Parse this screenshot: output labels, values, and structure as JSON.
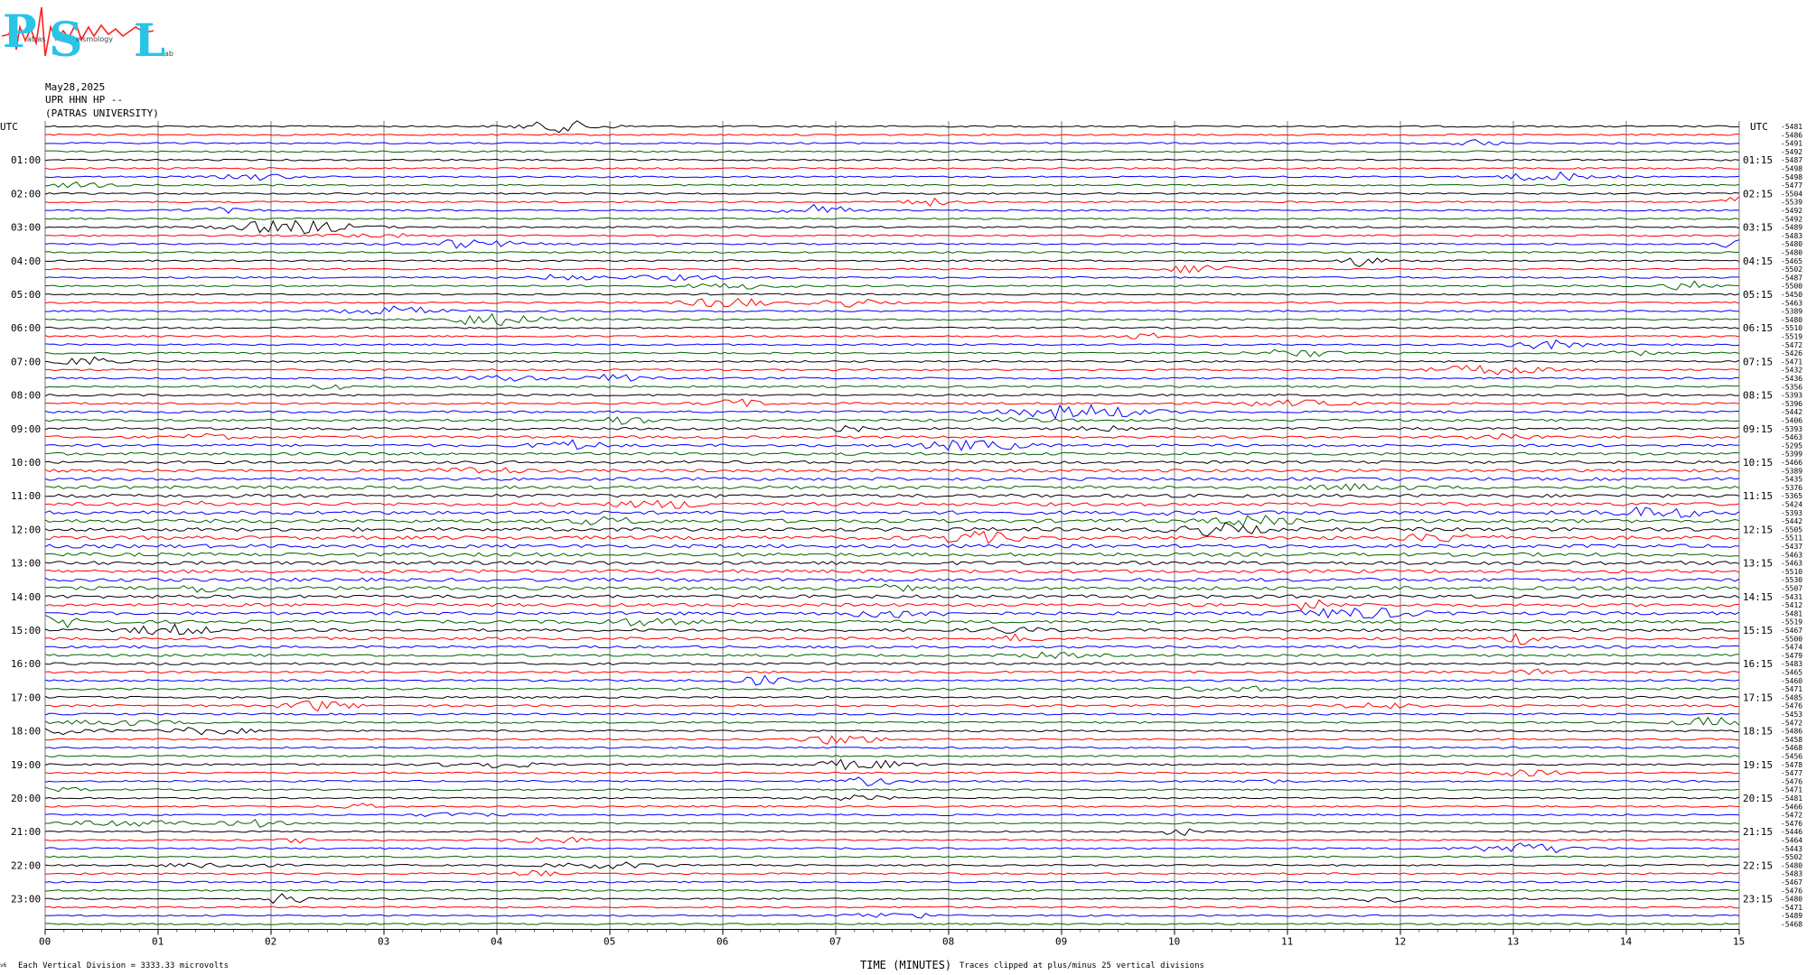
{
  "header": {
    "date": "May28,2025",
    "station": "UPR HHN HP --",
    "org": "(PATRAS UNIVERSITY)"
  },
  "logo": {
    "letters": [
      "P",
      "S",
      "L"
    ],
    "small_text": [
      "atras",
      "eismology",
      "ab"
    ],
    "colors": {
      "letters": "#29c4e6",
      "wave": "#ff2020"
    }
  },
  "footer": {
    "left": "Each Vertical Division = 3333.33 microvolts",
    "axis_title": "TIME (MINUTES)",
    "clip_note": "Traces clipped at plus/minus 25 vertical divisions",
    "version": "v6"
  },
  "chart_data": {
    "type": "line",
    "title": "",
    "xlabel": "TIME (MINUTES)",
    "ylabel": "",
    "xlim": [
      0,
      15
    ],
    "x_ticks": [
      "00",
      "01",
      "02",
      "03",
      "04",
      "05",
      "06",
      "07",
      "08",
      "09",
      "10",
      "11",
      "12",
      "13",
      "14",
      "15"
    ],
    "grid": true,
    "left_axis_header": "UTC",
    "right_axis_header": "UTC",
    "left_hour_labels": [
      "01:00",
      "02:00",
      "03:00",
      "04:00",
      "05:00",
      "06:00",
      "07:00",
      "08:00",
      "09:00",
      "10:00",
      "11:00",
      "12:00",
      "13:00",
      "14:00",
      "15:00",
      "16:00",
      "17:00",
      "18:00",
      "19:00",
      "20:00",
      "21:00",
      "22:00",
      "23:00"
    ],
    "right_hour_labels": [
      "01:15",
      "02:15",
      "03:15",
      "04:15",
      "05:15",
      "06:15",
      "07:15",
      "08:15",
      "09:15",
      "10:15",
      "11:15",
      "12:15",
      "13:15",
      "14:15",
      "15:15",
      "16:15",
      "17:15",
      "18:15",
      "19:15",
      "20:15",
      "21:15",
      "22:15",
      "23:15"
    ],
    "trace_colors": [
      "#000000",
      "#ff0000",
      "#0000ff",
      "#006400"
    ],
    "trace_count": 96,
    "trace_minutes_each": 15,
    "offsets": [
      "-5481",
      "-5486",
      "-5491",
      "-5492",
      "-5487",
      "-5498",
      "-5498",
      "-5477",
      "-5504",
      "-5539",
      "-5492",
      "-5492",
      "-5489",
      "-5483",
      "-5480",
      "-5480",
      "-5465",
      "-5502",
      "-5487",
      "-5500",
      "-5450",
      "-5463",
      "-5389",
      "-5480",
      "-5510",
      "-5519",
      "-5472",
      "-5426",
      "-5471",
      "-5432",
      "-5436",
      "-5356",
      "-5393",
      "-5396",
      "-5442",
      "-5406",
      "-5393",
      "-5463",
      "-5295",
      "-5399",
      "-5466",
      "-5389",
      "-5435",
      "-5376",
      "-5365",
      "-5424",
      "-5393",
      "-5442",
      "-5505",
      "-5511",
      "-5437",
      "-5463",
      "-5463",
      "-5510",
      "-5530",
      "-5507",
      "-5431",
      "-5412",
      "-5481",
      "-5519",
      "-5467",
      "-5500",
      "-5474",
      "-5479",
      "-5483",
      "-5465",
      "-5460",
      "-5471",
      "-5485",
      "-5476",
      "-5453",
      "-5472",
      "-5486",
      "-5458",
      "-5468",
      "-5456",
      "-5478",
      "-5477",
      "-5476",
      "-5471",
      "-5481",
      "-5466",
      "-5472",
      "-5476",
      "-5446",
      "-5464",
      "-5443",
      "-5502",
      "-5480",
      "-5483",
      "-5467",
      "-5476",
      "-5480",
      "-5471",
      "-5489",
      "-5468"
    ]
  }
}
